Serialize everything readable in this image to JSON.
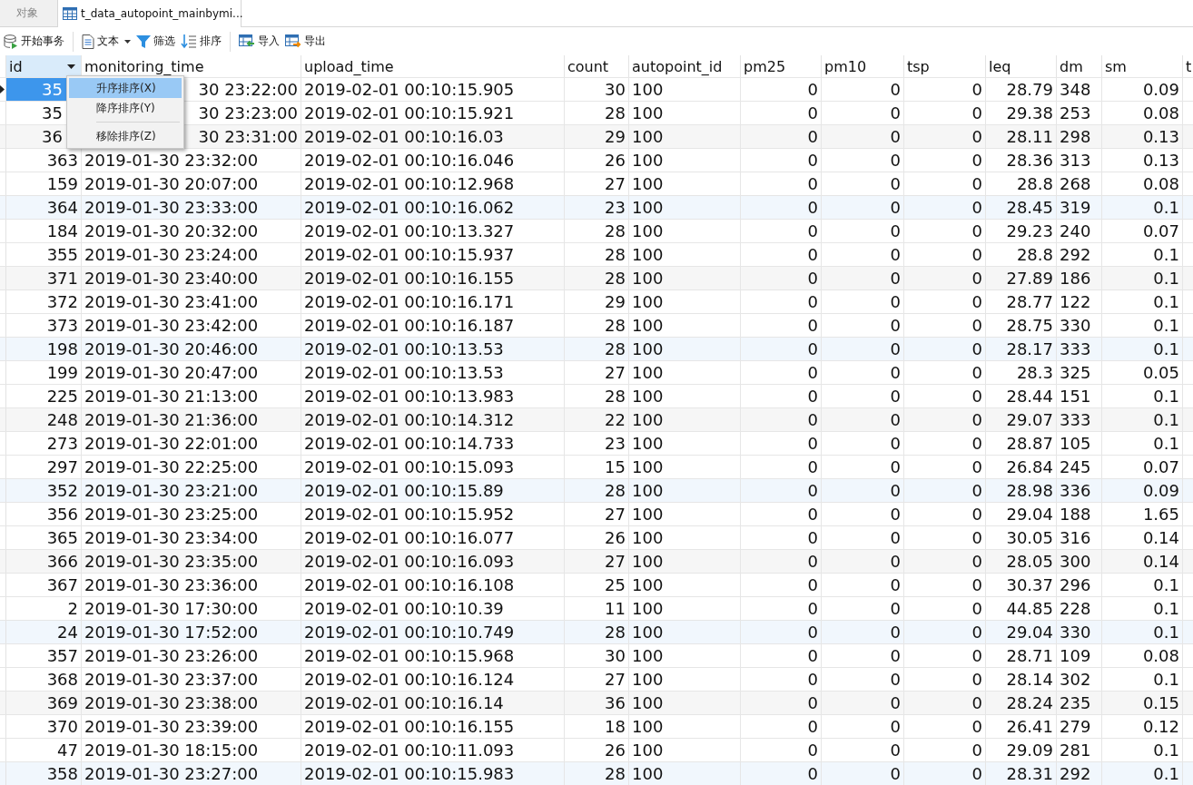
{
  "tabs": [
    {
      "label": "对象",
      "selected": false,
      "kind": "plain"
    },
    {
      "label": "t_data_autopoint_mainbymi...",
      "selected": true,
      "kind": "table"
    }
  ],
  "toolbar": [
    {
      "label": "开始事务",
      "kind": "transaction"
    },
    {
      "label": "文本",
      "kind": "text"
    },
    {
      "label": "筛选",
      "kind": "filter"
    },
    {
      "label": "排序",
      "kind": "sort"
    },
    {
      "label": "导入",
      "kind": "import"
    },
    {
      "label": "导出",
      "kind": "export"
    }
  ],
  "table": {
    "columns": [
      {
        "name": "id",
        "selected": true
      },
      {
        "name": "monitoring_time",
        "selected": false
      },
      {
        "name": "upload_time",
        "selected": false
      },
      {
        "name": "count",
        "selected": false
      },
      {
        "name": "autopoint_id",
        "selected": false
      },
      {
        "name": "pm25",
        "selected": false
      },
      {
        "name": "pm10",
        "selected": false
      },
      {
        "name": "tsp",
        "selected": false
      },
      {
        "name": "leq",
        "selected": false
      },
      {
        "name": "dm",
        "selected": false
      },
      {
        "name": "sm",
        "selected": false
      },
      {
        "name": "t",
        "selected": false
      }
    ],
    "rows": [
      {
        "selected": true,
        "under_menu": true,
        "cells": [
          "35",
          "30 23:22:00",
          "2019-02-01 00:10:15.905",
          "30",
          "100",
          "0",
          "0",
          "0",
          "28.79",
          "348",
          "0.09"
        ]
      },
      {
        "selected": false,
        "under_menu": true,
        "cells": [
          "35",
          "30 23:23:00",
          "2019-02-01 00:10:15.921",
          "28",
          "100",
          "0",
          "0",
          "0",
          "29.38",
          "253",
          "0.08"
        ]
      },
      {
        "selected": false,
        "under_menu": true,
        "cells": [
          "36",
          "30 23:31:00",
          "2019-02-01 00:10:16.03",
          "29",
          "100",
          "0",
          "0",
          "0",
          "28.11",
          "298",
          "0.13"
        ]
      },
      {
        "selected": false,
        "under_menu": false,
        "cells": [
          "363",
          "2019-01-30 23:32:00",
          "2019-02-01 00:10:16.046",
          "26",
          "100",
          "0",
          "0",
          "0",
          "28.36",
          "313",
          "0.13"
        ]
      },
      {
        "selected": false,
        "under_menu": false,
        "cells": [
          "159",
          "2019-01-30 20:07:00",
          "2019-02-01 00:10:12.968",
          "27",
          "100",
          "0",
          "0",
          "0",
          "28.8",
          "268",
          "0.08"
        ]
      },
      {
        "selected": false,
        "under_menu": false,
        "cells": [
          "364",
          "2019-01-30 23:33:00",
          "2019-02-01 00:10:16.062",
          "23",
          "100",
          "0",
          "0",
          "0",
          "28.45",
          "319",
          "0.1"
        ]
      },
      {
        "selected": false,
        "under_menu": false,
        "cells": [
          "184",
          "2019-01-30 20:32:00",
          "2019-02-01 00:10:13.327",
          "28",
          "100",
          "0",
          "0",
          "0",
          "29.23",
          "240",
          "0.07"
        ]
      },
      {
        "selected": false,
        "under_menu": false,
        "cells": [
          "355",
          "2019-01-30 23:24:00",
          "2019-02-01 00:10:15.937",
          "28",
          "100",
          "0",
          "0",
          "0",
          "28.8",
          "292",
          "0.1"
        ]
      },
      {
        "selected": false,
        "under_menu": false,
        "cells": [
          "371",
          "2019-01-30 23:40:00",
          "2019-02-01 00:10:16.155",
          "28",
          "100",
          "0",
          "0",
          "0",
          "27.89",
          "186",
          "0.1"
        ]
      },
      {
        "selected": false,
        "under_menu": false,
        "cells": [
          "372",
          "2019-01-30 23:41:00",
          "2019-02-01 00:10:16.171",
          "29",
          "100",
          "0",
          "0",
          "0",
          "28.77",
          "122",
          "0.1"
        ]
      },
      {
        "selected": false,
        "under_menu": false,
        "cells": [
          "373",
          "2019-01-30 23:42:00",
          "2019-02-01 00:10:16.187",
          "28",
          "100",
          "0",
          "0",
          "0",
          "28.75",
          "330",
          "0.1"
        ]
      },
      {
        "selected": false,
        "under_menu": false,
        "cells": [
          "198",
          "2019-01-30 20:46:00",
          "2019-02-01 00:10:13.53",
          "28",
          "100",
          "0",
          "0",
          "0",
          "28.17",
          "333",
          "0.1"
        ]
      },
      {
        "selected": false,
        "under_menu": false,
        "cells": [
          "199",
          "2019-01-30 20:47:00",
          "2019-02-01 00:10:13.53",
          "27",
          "100",
          "0",
          "0",
          "0",
          "28.3",
          "325",
          "0.05"
        ]
      },
      {
        "selected": false,
        "under_menu": false,
        "cells": [
          "225",
          "2019-01-30 21:13:00",
          "2019-02-01 00:10:13.983",
          "28",
          "100",
          "0",
          "0",
          "0",
          "28.44",
          "151",
          "0.1"
        ]
      },
      {
        "selected": false,
        "under_menu": false,
        "cells": [
          "248",
          "2019-01-30 21:36:00",
          "2019-02-01 00:10:14.312",
          "22",
          "100",
          "0",
          "0",
          "0",
          "29.07",
          "333",
          "0.1"
        ]
      },
      {
        "selected": false,
        "under_menu": false,
        "cells": [
          "273",
          "2019-01-30 22:01:00",
          "2019-02-01 00:10:14.733",
          "23",
          "100",
          "0",
          "0",
          "0",
          "28.87",
          "105",
          "0.1"
        ]
      },
      {
        "selected": false,
        "under_menu": false,
        "cells": [
          "297",
          "2019-01-30 22:25:00",
          "2019-02-01 00:10:15.093",
          "15",
          "100",
          "0",
          "0",
          "0",
          "26.84",
          "245",
          "0.07"
        ]
      },
      {
        "selected": false,
        "under_menu": false,
        "cells": [
          "352",
          "2019-01-30 23:21:00",
          "2019-02-01 00:10:15.89",
          "28",
          "100",
          "0",
          "0",
          "0",
          "28.98",
          "336",
          "0.09"
        ]
      },
      {
        "selected": false,
        "under_menu": false,
        "cells": [
          "356",
          "2019-01-30 23:25:00",
          "2019-02-01 00:10:15.952",
          "27",
          "100",
          "0",
          "0",
          "0",
          "29.04",
          "188",
          "1.65"
        ]
      },
      {
        "selected": false,
        "under_menu": false,
        "cells": [
          "365",
          "2019-01-30 23:34:00",
          "2019-02-01 00:10:16.077",
          "26",
          "100",
          "0",
          "0",
          "0",
          "30.05",
          "316",
          "0.14"
        ]
      },
      {
        "selected": false,
        "under_menu": false,
        "cells": [
          "366",
          "2019-01-30 23:35:00",
          "2019-02-01 00:10:16.093",
          "27",
          "100",
          "0",
          "0",
          "0",
          "28.05",
          "300",
          "0.14"
        ]
      },
      {
        "selected": false,
        "under_menu": false,
        "cells": [
          "367",
          "2019-01-30 23:36:00",
          "2019-02-01 00:10:16.108",
          "25",
          "100",
          "0",
          "0",
          "0",
          "30.37",
          "296",
          "0.1"
        ]
      },
      {
        "selected": false,
        "under_menu": false,
        "cells": [
          "2",
          "2019-01-30 17:30:00",
          "2019-02-01 00:10:10.39",
          "11",
          "100",
          "0",
          "0",
          "0",
          "44.85",
          "228",
          "0.1"
        ]
      },
      {
        "selected": false,
        "under_menu": false,
        "cells": [
          "24",
          "2019-01-30 17:52:00",
          "2019-02-01 00:10:10.749",
          "28",
          "100",
          "0",
          "0",
          "0",
          "29.04",
          "330",
          "0.1"
        ]
      },
      {
        "selected": false,
        "under_menu": false,
        "cells": [
          "357",
          "2019-01-30 23:26:00",
          "2019-02-01 00:10:15.968",
          "30",
          "100",
          "0",
          "0",
          "0",
          "28.71",
          "109",
          "0.08"
        ]
      },
      {
        "selected": false,
        "under_menu": false,
        "cells": [
          "368",
          "2019-01-30 23:37:00",
          "2019-02-01 00:10:16.124",
          "27",
          "100",
          "0",
          "0",
          "0",
          "28.14",
          "302",
          "0.1"
        ]
      },
      {
        "selected": false,
        "under_menu": false,
        "cells": [
          "369",
          "2019-01-30 23:38:00",
          "2019-02-01 00:10:16.14",
          "36",
          "100",
          "0",
          "0",
          "0",
          "28.24",
          "235",
          "0.15"
        ]
      },
      {
        "selected": false,
        "under_menu": false,
        "cells": [
          "370",
          "2019-01-30 23:39:00",
          "2019-02-01 00:10:16.155",
          "18",
          "100",
          "0",
          "0",
          "0",
          "26.41",
          "279",
          "0.12"
        ]
      },
      {
        "selected": false,
        "under_menu": false,
        "cells": [
          "47",
          "2019-01-30 18:15:00",
          "2019-02-01 00:10:11.093",
          "26",
          "100",
          "0",
          "0",
          "0",
          "29.09",
          "281",
          "0.1"
        ]
      },
      {
        "selected": false,
        "under_menu": false,
        "cells": [
          "358",
          "2019-01-30 23:27:00",
          "2019-02-01 00:10:15.983",
          "28",
          "100",
          "0",
          "0",
          "0",
          "28.31",
          "292",
          "0.1"
        ]
      }
    ]
  },
  "context_menu": [
    {
      "kind": "item",
      "label": "升序排序(X)",
      "selected": true
    },
    {
      "kind": "item",
      "label": "降序排序(Y)",
      "selected": false
    },
    {
      "kind": "separator"
    },
    {
      "kind": "item",
      "label": "移除排序(Z)",
      "selected": false
    }
  ]
}
